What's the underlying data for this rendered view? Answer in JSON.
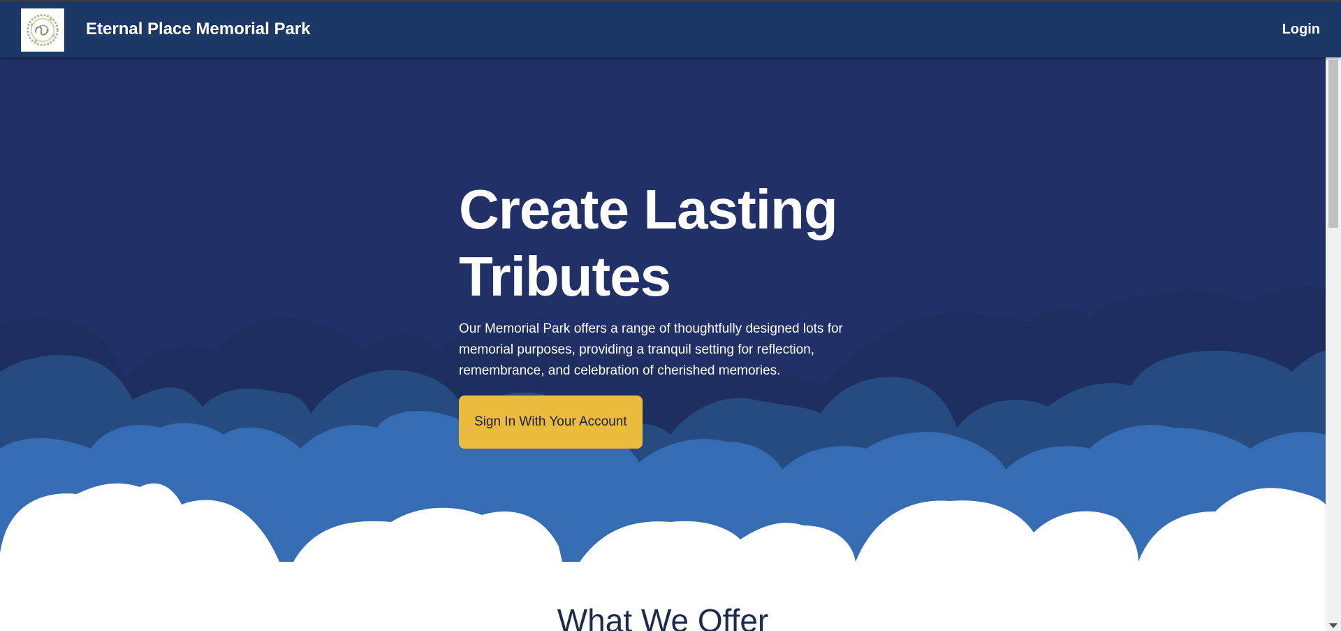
{
  "header": {
    "brand": "Eternal Place Memorial Park",
    "login_label": "Login",
    "logo_icon": "floral-wreath-logo-icon"
  },
  "hero": {
    "title": "Create Lasting Tributes",
    "description": "Our Memorial Park offers a range of thoughtfully designed lots for memorial purposes, providing a tranquil setting for reflection, remembrance, and celebration of cherished memories.",
    "cta_label": "Sign In With Your Account"
  },
  "section": {
    "title": "What We Offer"
  },
  "colors": {
    "nav": "#1b3866",
    "hero_bg": "#213066",
    "wave_dark": "#1c2f5f",
    "wave_mid": "#264b80",
    "wave_light": "#366cb3",
    "accent": "#ebbb3e"
  }
}
